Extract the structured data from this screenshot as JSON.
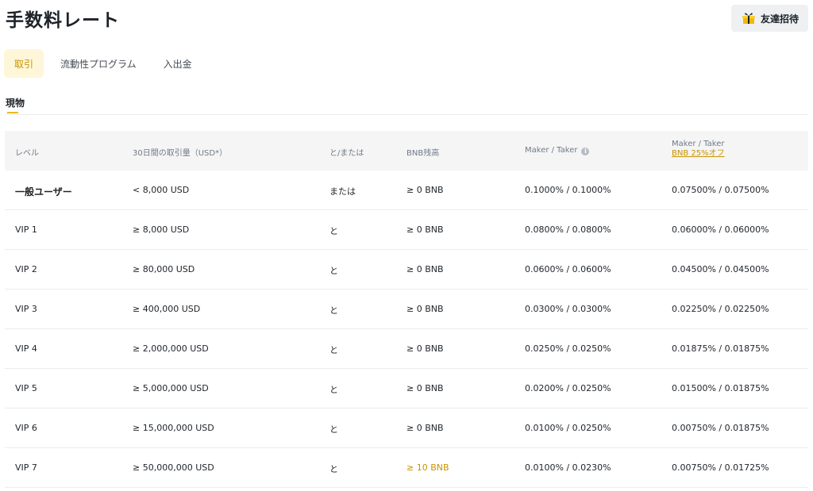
{
  "header": {
    "title": "手数料レート",
    "invite_button": "友達招待",
    "invite_icon": "gift-icon"
  },
  "tabs": [
    {
      "label": "取引",
      "active": true
    },
    {
      "label": "流動性プログラム",
      "active": false
    },
    {
      "label": "入出金",
      "active": false
    }
  ],
  "subtab": {
    "label": "現物"
  },
  "table": {
    "headers": {
      "level": "レベル",
      "volume": "30日間の取引量（USD*）",
      "andor": "と/または",
      "bnb": "BNB残高",
      "maker_taker": "Maker / Taker",
      "maker_taker_bnb": "Maker / Taker",
      "bnb_discount": "BNB 25%オフ"
    },
    "rows": [
      {
        "level": "一般ユーザー",
        "volume": "< 8,000 USD",
        "andor": "または",
        "bnb": "≥ 0 BNB",
        "maker_taker": "0.1000% / 0.1000%",
        "maker_taker_bnb": "0.07500% / 0.07500%"
      },
      {
        "level": "VIP 1",
        "volume": "≥ 8,000 USD",
        "andor": "と",
        "bnb": "≥ 0 BNB",
        "maker_taker": "0.0800% / 0.0800%",
        "maker_taker_bnb": "0.06000% / 0.06000%"
      },
      {
        "level": "VIP 2",
        "volume": "≥ 80,000 USD",
        "andor": "と",
        "bnb": "≥ 0 BNB",
        "maker_taker": "0.0600% / 0.0600%",
        "maker_taker_bnb": "0.04500% / 0.04500%"
      },
      {
        "level": "VIP 3",
        "volume": "≥ 400,000 USD",
        "andor": "と",
        "bnb": "≥ 0 BNB",
        "maker_taker": "0.0300% / 0.0300%",
        "maker_taker_bnb": "0.02250% / 0.02250%"
      },
      {
        "level": "VIP 4",
        "volume": "≥ 2,000,000 USD",
        "andor": "と",
        "bnb": "≥ 0 BNB",
        "maker_taker": "0.0250% / 0.0250%",
        "maker_taker_bnb": "0.01875% / 0.01875%"
      },
      {
        "level": "VIP 5",
        "volume": "≥ 5,000,000 USD",
        "andor": "と",
        "bnb": "≥ 0 BNB",
        "maker_taker": "0.0200% / 0.0250%",
        "maker_taker_bnb": "0.01500% / 0.01875%"
      },
      {
        "level": "VIP 6",
        "volume": "≥ 15,000,000 USD",
        "andor": "と",
        "bnb": "≥ 0 BNB",
        "maker_taker": "0.0100% / 0.0250%",
        "maker_taker_bnb": "0.00750% / 0.01875%"
      },
      {
        "level": "VIP 7",
        "volume": "≥ 50,000,000 USD",
        "andor": "と",
        "bnb": "≥ 10 BNB",
        "maker_taker": "0.0100% / 0.0230%",
        "maker_taker_bnb": "0.00750% / 0.01725%"
      }
    ]
  },
  "colors": {
    "accent": "#f0b90b",
    "accent_text": "#c99400",
    "tab_active_bg": "#fef6d8",
    "header_bg": "#f5f5f5"
  }
}
